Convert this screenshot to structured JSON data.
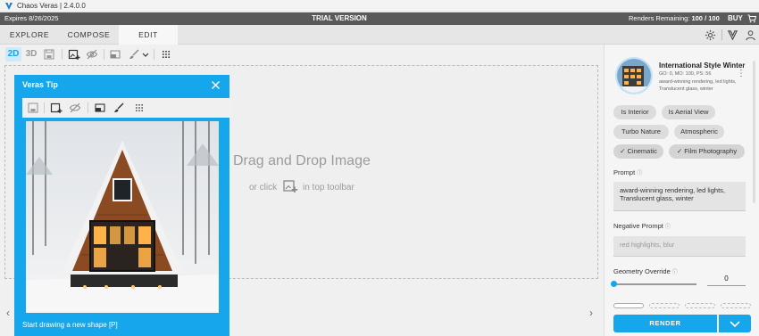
{
  "app": {
    "title": "Chaos Veras | 2.4.0.0"
  },
  "trial": {
    "expires": "Expires 8/26/2025",
    "label": "TRIAL VERSION",
    "renders_label": "Renders Remaining:",
    "renders_value": "100 / 100",
    "buy_now": "BUY NOW"
  },
  "tabs": [
    {
      "label": "EXPLORE",
      "active": false
    },
    {
      "label": "COMPOSE",
      "active": false
    },
    {
      "label": "EDIT",
      "active": true
    }
  ],
  "toolbar": {
    "mode_2d": "2D",
    "mode_3d": "3D",
    "active_mode": "2D"
  },
  "canvas": {
    "dnd_title": "Drag and Drop Image",
    "dnd_or": "or click",
    "dnd_rest": "in top toolbar"
  },
  "tip": {
    "title": "Veras Tip",
    "footer": "Start drawing a new shape [P]"
  },
  "panel": {
    "style_name": "International Style Winter",
    "style_meta": "GO: 0, MO: 100, PS: 56",
    "style_desc": "award-winning rendering, led lights, Translucent glass, winter",
    "chips": [
      {
        "label": "Is Interior",
        "selected": false
      },
      {
        "label": "Is Aerial View",
        "selected": false
      },
      {
        "label": "Turbo Nature",
        "selected": false
      },
      {
        "label": "Atmospheric",
        "selected": false
      },
      {
        "label": "✓ Cinematic",
        "selected": true
      },
      {
        "label": "✓ Film Photography",
        "selected": true
      }
    ],
    "prompt_label": "Prompt",
    "prompt_value": "award-winning rendering, led lights, Translucent glass, winter",
    "negative_label": "Negative Prompt",
    "negative_placeholder": "red highlights, blur",
    "geometry_label": "Geometry Override",
    "geometry_value": "0",
    "render_label": "RENDER"
  },
  "colors": {
    "accent": "#15a6eb",
    "trialbar": "#5a5a5a"
  },
  "icons": [
    "veras-logo-icon",
    "cart-icon",
    "gear-icon",
    "brand-icon",
    "user-icon",
    "save-icon",
    "add-image-icon",
    "hide-icon",
    "mask-icon",
    "brush-icon",
    "chevron-down-icon",
    "grid-icon",
    "close-icon",
    "chevron-left-icon",
    "chevron-right-icon",
    "kebab-icon"
  ]
}
